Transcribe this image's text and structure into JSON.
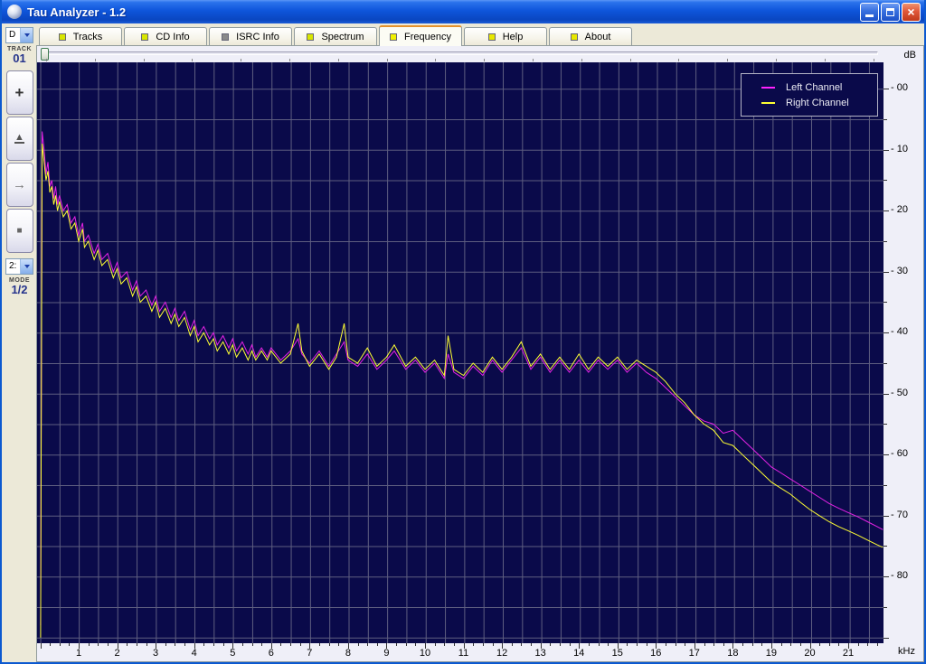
{
  "window": {
    "title": "Tau Analyzer - 1.2"
  },
  "window_controls": [
    {
      "name": "minimize"
    },
    {
      "name": "restore"
    },
    {
      "name": "close"
    }
  ],
  "tabs": [
    {
      "label": "Tracks",
      "icon": "flag-icon",
      "icon_color": "#D8E600",
      "active": false
    },
    {
      "label": "CD Info",
      "icon": "flag-icon",
      "icon_color": "#D8E600",
      "active": false
    },
    {
      "label": "ISRC Info",
      "icon": "flag-icon",
      "icon_color": "#8A8A8A",
      "active": false
    },
    {
      "label": "Spectrum",
      "icon": "flag-icon",
      "icon_color": "#D8E600",
      "active": false
    },
    {
      "label": "Frequency",
      "icon": "flag-icon",
      "icon_color": "#F0F000",
      "active": true
    },
    {
      "label": "Help",
      "icon": "flag-icon",
      "icon_color": "#E8E800",
      "active": false
    },
    {
      "label": "About",
      "icon": "flag-icon",
      "icon_color": "#E8E800",
      "active": false
    }
  ],
  "sidebar": {
    "drive_selector": {
      "value": "D"
    },
    "track_label": "TRACK",
    "track_number": "01",
    "transport_buttons": [
      {
        "name": "add-button",
        "glyph": "+",
        "style": "plus"
      },
      {
        "name": "eject-button",
        "glyph": "▲",
        "style": "eject"
      },
      {
        "name": "next-button",
        "glyph": "→",
        "style": "next"
      },
      {
        "name": "stop-button",
        "glyph": "■",
        "style": "stop"
      }
    ],
    "mode_selector": {
      "value": "2:"
    },
    "mode_label": "MODE",
    "mode_value": "1/2"
  },
  "legend": {
    "entries": [
      {
        "label": "Left Channel",
        "color": "#FF22FF"
      },
      {
        "label": "Right Channel",
        "color": "#FFFF33"
      }
    ]
  },
  "colors": {
    "plot_bg": "#0A0A4A",
    "grid": "#5E5E80",
    "left_channel": "#E522E5",
    "right_channel": "#FFFF33",
    "active_tab_accent": "#E5922D"
  },
  "chart_data": {
    "type": "line",
    "title": "",
    "xlabel": "kHz",
    "ylabel": "dB",
    "xlim": [
      0,
      22
    ],
    "ylim": [
      -91,
      4
    ],
    "grid": {
      "x_step_khz": 0.5,
      "y_step_db": 5
    },
    "legend_position": "top-right",
    "x_tick_labels": [
      1,
      2,
      3,
      4,
      5,
      6,
      7,
      8,
      9,
      10,
      11,
      12,
      13,
      14,
      15,
      16,
      17,
      18,
      19,
      20,
      21
    ],
    "y_tick_labels": [
      "- 00",
      "- 10",
      "- 20",
      "- 30",
      "- 40",
      "- 50",
      "- 60",
      "- 70",
      "- 80"
    ],
    "y_tick_values": [
      0,
      -10,
      -20,
      -30,
      -40,
      -50,
      -60,
      -70,
      -80
    ],
    "x": [
      0.01,
      0.05,
      0.1,
      0.15,
      0.2,
      0.25,
      0.3,
      0.35,
      0.4,
      0.45,
      0.5,
      0.6,
      0.7,
      0.8,
      0.9,
      1.0,
      1.1,
      1.15,
      1.25,
      1.4,
      1.5,
      1.6,
      1.75,
      1.9,
      2.0,
      2.1,
      2.25,
      2.4,
      2.5,
      2.6,
      2.75,
      2.9,
      3.0,
      3.1,
      3.25,
      3.4,
      3.5,
      3.6,
      3.75,
      3.9,
      4.0,
      4.1,
      4.25,
      4.4,
      4.5,
      4.6,
      4.75,
      4.9,
      5.0,
      5.1,
      5.25,
      5.4,
      5.5,
      5.6,
      5.75,
      5.9,
      6.0,
      6.25,
      6.5,
      6.7,
      6.8,
      7.0,
      7.25,
      7.5,
      7.7,
      7.9,
      8.0,
      8.25,
      8.5,
      8.75,
      9.0,
      9.2,
      9.5,
      9.75,
      10.0,
      10.25,
      10.5,
      10.6,
      10.75,
      11.0,
      11.25,
      11.5,
      11.75,
      12.0,
      12.25,
      12.5,
      12.75,
      13.0,
      13.25,
      13.5,
      13.75,
      14.0,
      14.25,
      14.5,
      14.75,
      15.0,
      15.25,
      15.5,
      15.75,
      16.0,
      16.25,
      16.5,
      16.75,
      17.0,
      17.25,
      17.5,
      17.75,
      18.0,
      18.25,
      18.5,
      18.75,
      19.0,
      19.25,
      19.5,
      19.75,
      20.0,
      20.25,
      20.5,
      20.75,
      21.0,
      21.25,
      21.5,
      21.75,
      21.9
    ],
    "series": [
      {
        "name": "Left Channel",
        "color": "#E522E5",
        "y": [
          -88,
          -7,
          -10,
          -14,
          -12,
          -16,
          -15,
          -18,
          -16,
          -19,
          -17.5,
          -20,
          -19,
          -22,
          -21,
          -24,
          -22,
          -25,
          -24,
          -27,
          -25.5,
          -28,
          -27,
          -30,
          -28.5,
          -31,
          -30,
          -33,
          -31.5,
          -34,
          -33,
          -35.5,
          -34,
          -36.5,
          -35,
          -37.5,
          -36,
          -38,
          -36.5,
          -39.5,
          -38,
          -40.5,
          -39,
          -41,
          -40,
          -42,
          -40.5,
          -42.5,
          -41,
          -43,
          -41.5,
          -43.5,
          -42,
          -44,
          -42.5,
          -44,
          -42.5,
          -44.5,
          -43,
          -41,
          -43.5,
          -45,
          -43,
          -45.5,
          -43.5,
          -41.5,
          -44.5,
          -45.5,
          -43.5,
          -46,
          -44.5,
          -43,
          -46,
          -44.5,
          -46.5,
          -45,
          -47.5,
          -43.5,
          -46.5,
          -47.5,
          -45.5,
          -47,
          -44.5,
          -46.5,
          -44.5,
          -42.5,
          -46,
          -44,
          -46.5,
          -44.5,
          -46.5,
          -44.5,
          -46.5,
          -44.5,
          -46,
          -44.5,
          -46.5,
          -45,
          -46.5,
          -47.5,
          -49,
          -50.5,
          -52,
          -53.5,
          -54.5,
          -55,
          -56.5,
          -56,
          -57.5,
          -59,
          -60.5,
          -62,
          -63,
          -64,
          -65,
          -66,
          -67,
          -68,
          -68.8,
          -69.5,
          -70.2,
          -71,
          -71.8,
          -72.3
        ]
      },
      {
        "name": "Right Channel",
        "color": "#FFFF33",
        "y": [
          -90,
          -9,
          -12,
          -15,
          -13.5,
          -17,
          -16,
          -19,
          -17.5,
          -20,
          -18.5,
          -21,
          -20,
          -23,
          -22,
          -25,
          -23,
          -26,
          -25,
          -28,
          -26.5,
          -29,
          -28,
          -31,
          -29.5,
          -32,
          -31,
          -34,
          -32.5,
          -35,
          -34,
          -36.5,
          -35,
          -37.5,
          -36,
          -38.5,
          -37,
          -39,
          -37.5,
          -40.5,
          -39,
          -41.5,
          -40,
          -42,
          -41,
          -43,
          -41.5,
          -43.5,
          -42,
          -44,
          -42.5,
          -44.5,
          -43,
          -44.5,
          -43,
          -44.5,
          -43,
          -45,
          -43.5,
          -38.5,
          -43,
          -45.5,
          -43.5,
          -46,
          -44,
          -38.5,
          -44,
          -45,
          -42.5,
          -45.5,
          -44,
          -42,
          -45.5,
          -44,
          -46,
          -44.5,
          -47,
          -40.5,
          -46,
          -47,
          -45,
          -46.5,
          -44,
          -46,
          -44,
          -41.5,
          -45.5,
          -43.5,
          -46,
          -44,
          -46,
          -43.5,
          -46,
          -44,
          -45.5,
          -44,
          -46,
          -44.5,
          -45.5,
          -46.5,
          -48,
          -50,
          -51.5,
          -53.5,
          -55,
          -56,
          -58,
          -58.5,
          -60,
          -61.5,
          -63,
          -64.5,
          -65.5,
          -66.5,
          -67.8,
          -69,
          -70,
          -71,
          -71.8,
          -72.5,
          -73.2,
          -74,
          -74.8,
          -75.2
        ]
      }
    ]
  }
}
